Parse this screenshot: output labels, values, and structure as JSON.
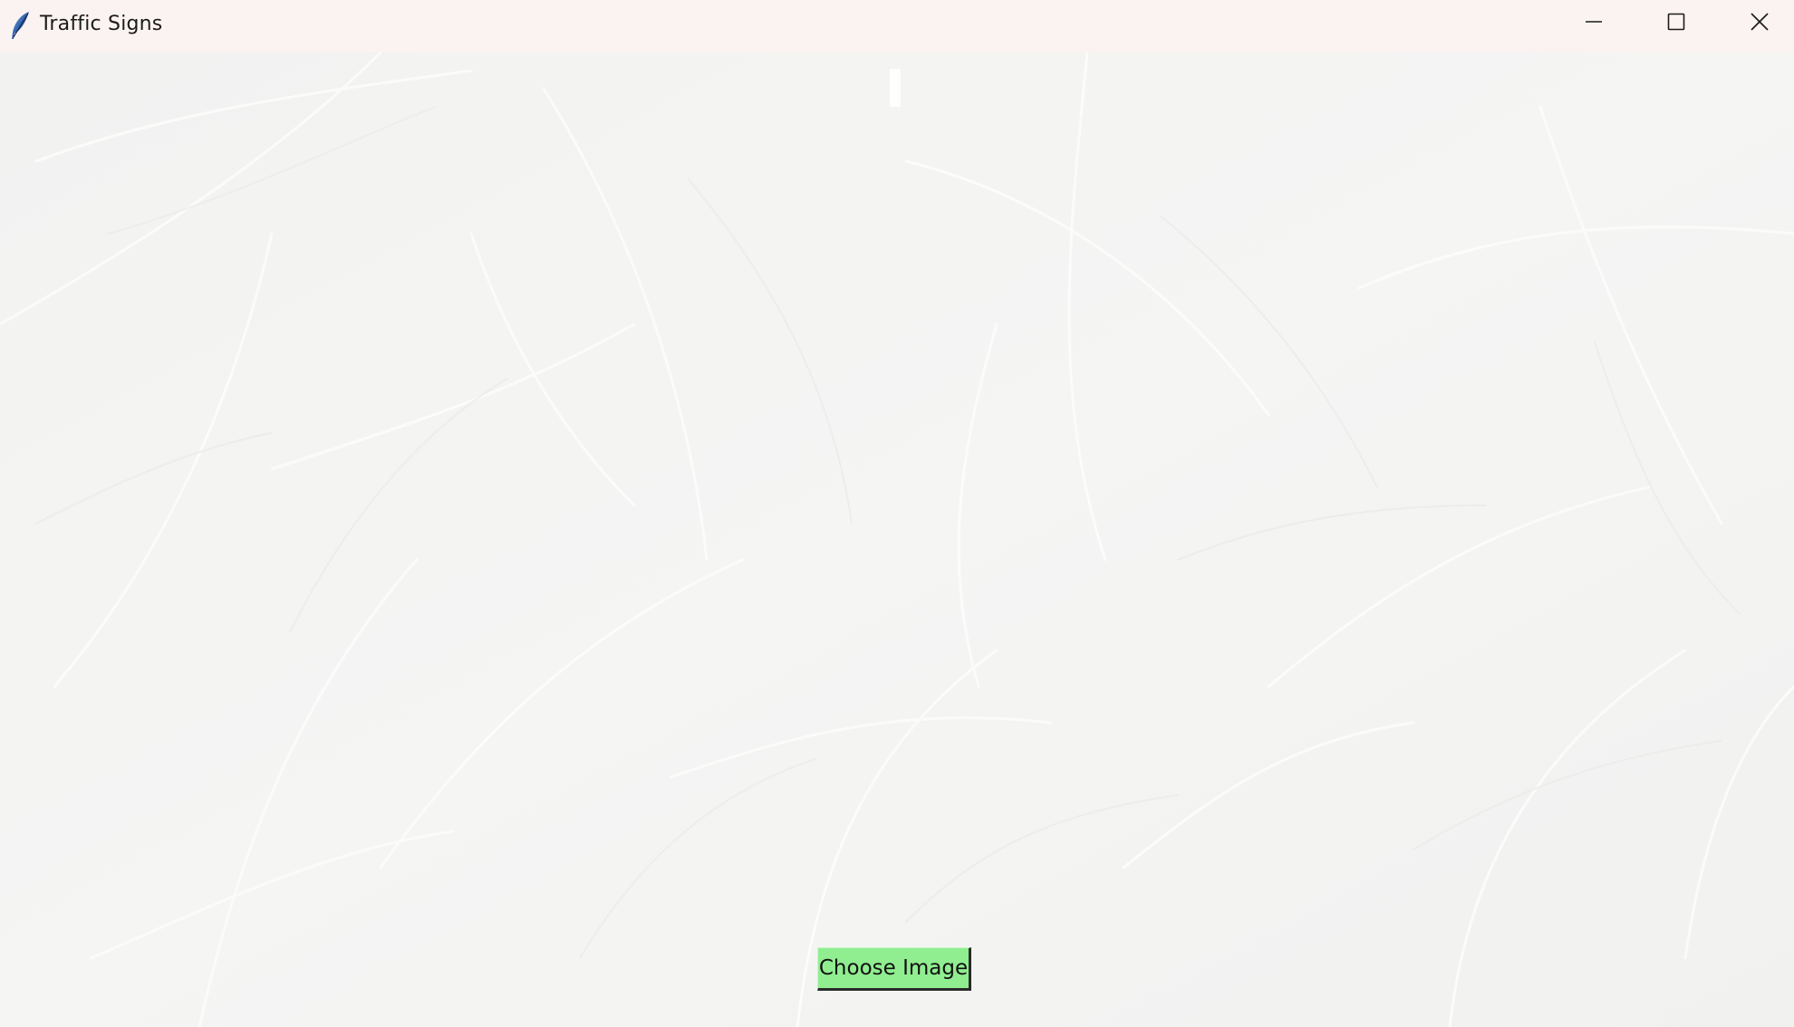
{
  "window": {
    "title": "Traffic Signs",
    "icon": "feather-icon",
    "controls": {
      "minimize_icon": "minimize-icon",
      "maximize_icon": "maximize-icon",
      "close_icon": "close-icon"
    }
  },
  "main": {
    "choose_button_label": "Choose Image",
    "button_color": "#90ee90"
  }
}
